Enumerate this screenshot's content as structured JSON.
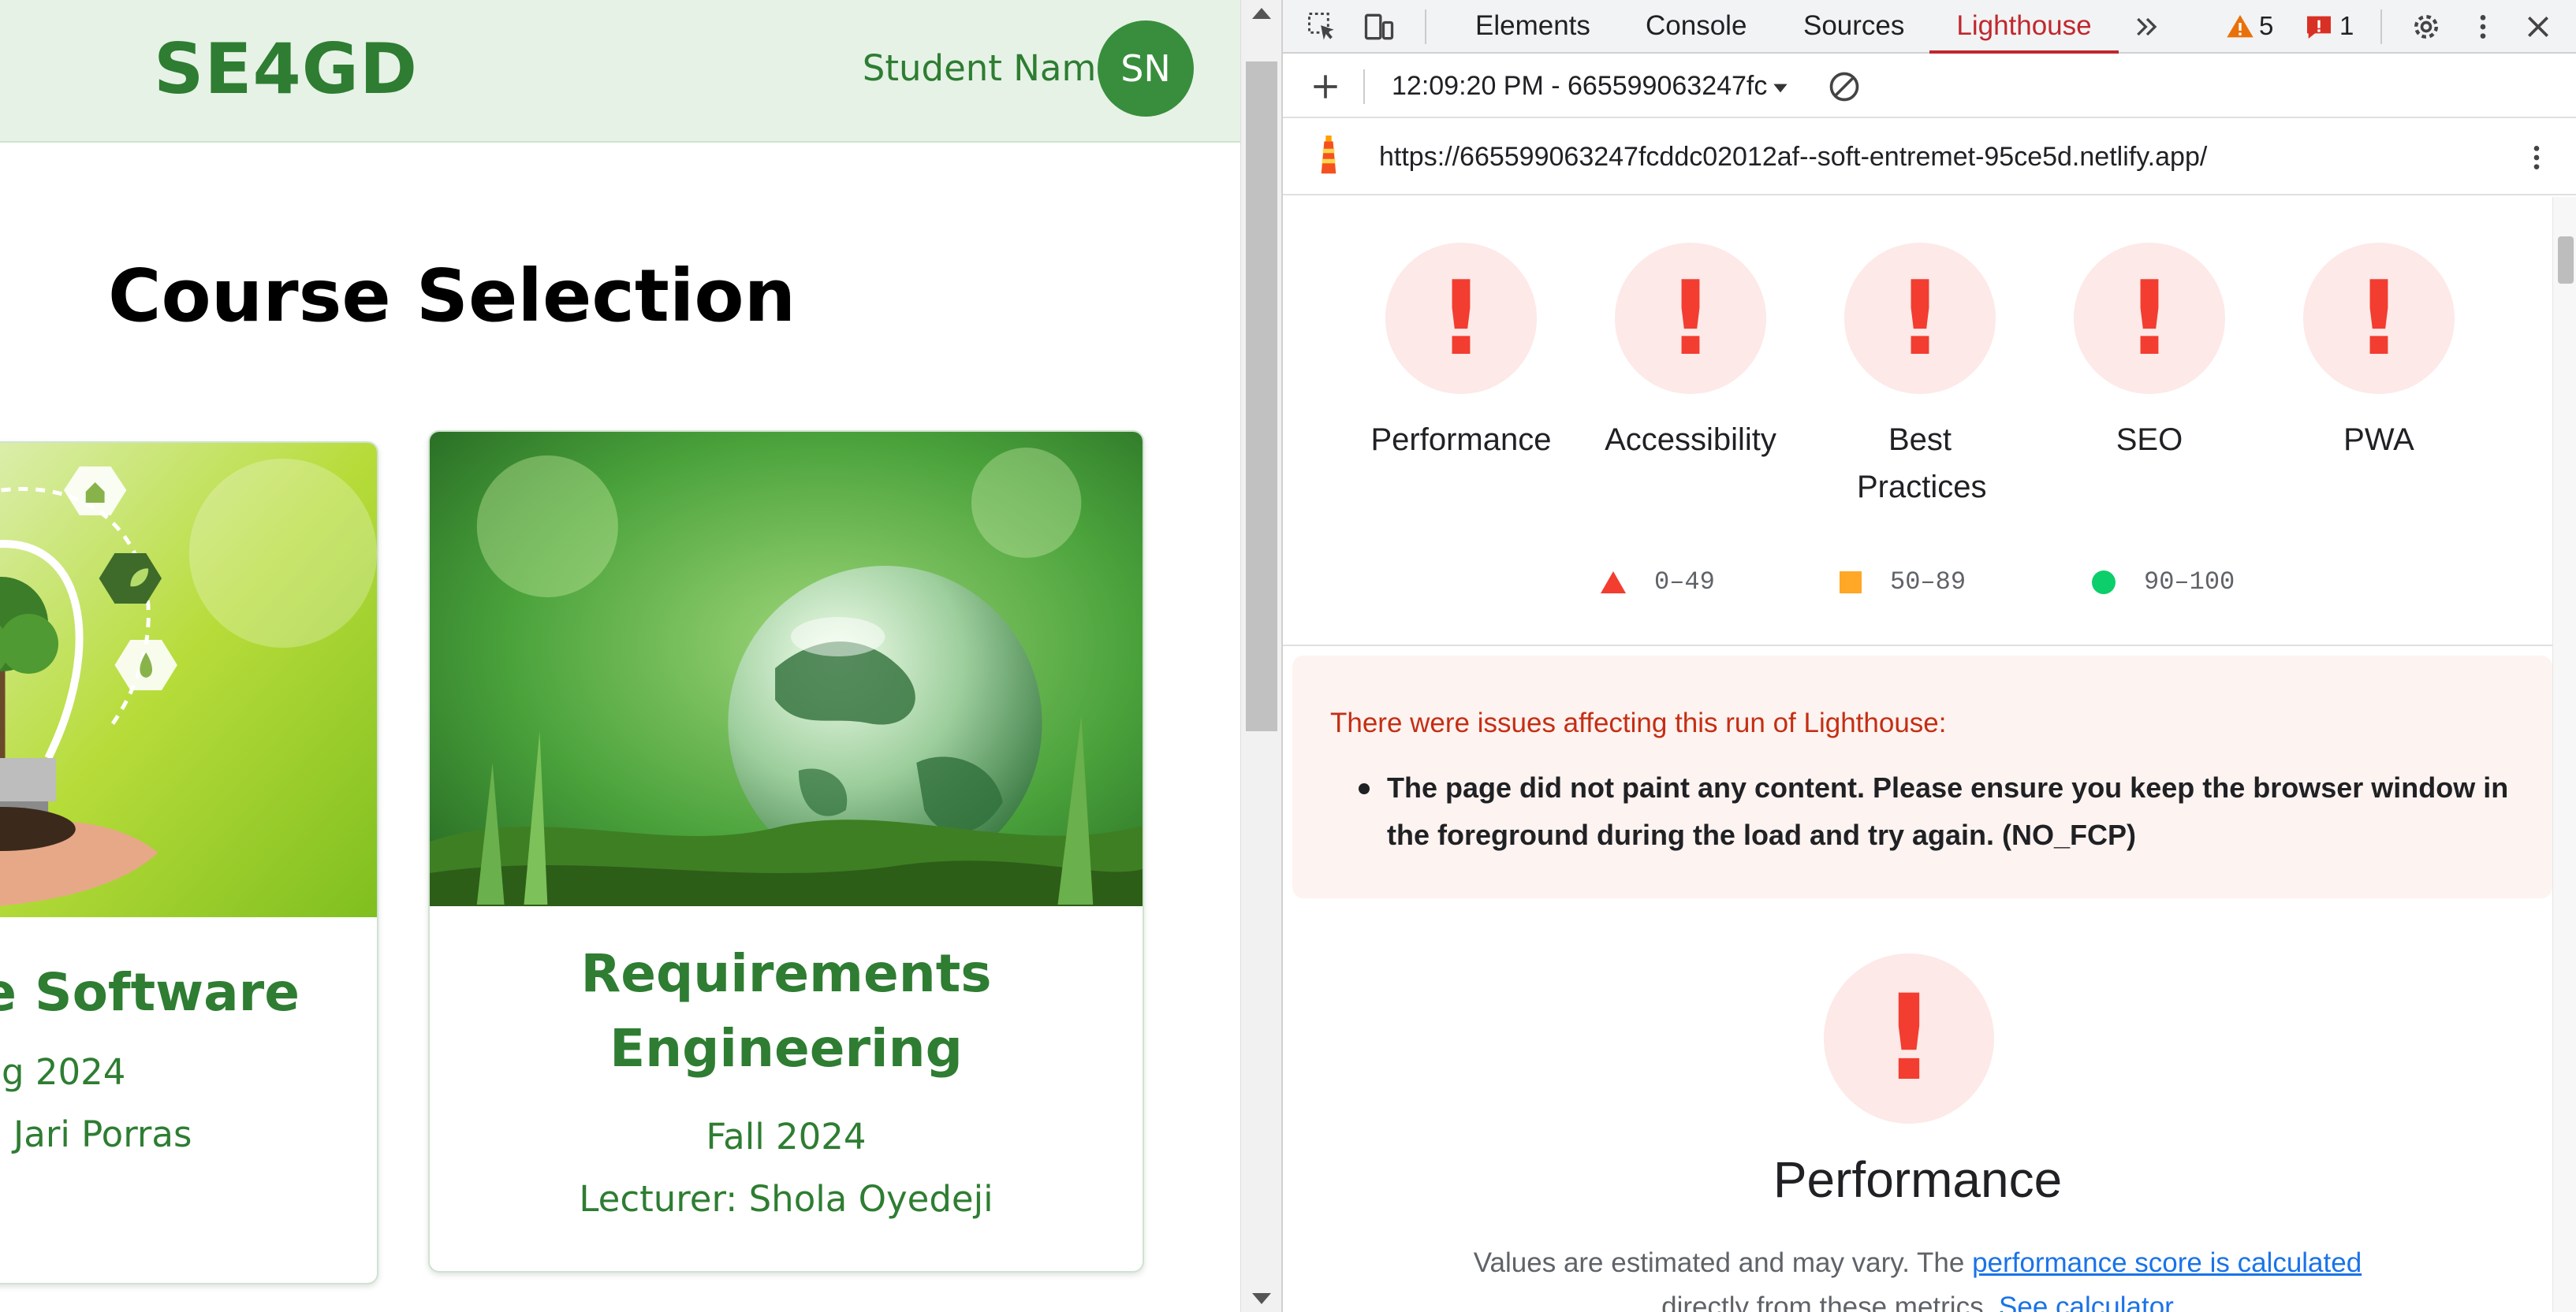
{
  "site": {
    "logo": "SE4GD",
    "student_name": "Student Name",
    "avatar_initials": "SN",
    "page_title": "Course Selection"
  },
  "courses": [
    {
      "title": "le Software",
      "season": "g 2024",
      "lecturer": "Jari Porras"
    },
    {
      "title_line1": "Requirements",
      "title_line2": "Engineering",
      "season": "Fall 2024",
      "lecturer": "Lecturer: Shola Oyedeji"
    }
  ],
  "devtools": {
    "tabs": [
      "Elements",
      "Console",
      "Sources",
      "Lighthouse"
    ],
    "active_tab": "Lighthouse",
    "warnings_count": "5",
    "errors_count": "1",
    "report_time": "12:09:20 PM - 665599063247fc",
    "report_url": "https://665599063247fcddc02012af--soft-entremet-95ce5d.netlify.app/",
    "categories": [
      "Performance",
      "Accessibility",
      "Best Practices",
      "SEO",
      "PWA"
    ],
    "gauge_mark": "!",
    "legend": [
      "0–49",
      "50–89",
      "90–100"
    ],
    "warning_title": "There were issues affecting this run of Lighthouse:",
    "warning_item": "The page did not paint any content. Please ensure you keep the browser window in the foreground during the load and try again. (NO_FCP)",
    "perf_title": "Performance",
    "perf_note_pre": "Values are estimated and may vary. The ",
    "perf_note_link1": "performance score is calculated",
    "perf_note_mid": "directly from these metrics. ",
    "perf_note_link2": "See calculator"
  },
  "colors": {
    "brand_green": "#2e7d32",
    "header_bg": "#e6f2e6",
    "lighthouse_red": "#f23d30",
    "gauge_bg": "#fde9e7",
    "active_tab": "#c1272d",
    "link_blue": "#1a73e8"
  },
  "icons": [
    "inspect-icon",
    "device-toolbar-icon",
    "more-tabs-icon",
    "warning-icon",
    "error-icon",
    "settings-icon",
    "kebab-menu-icon",
    "close-icon",
    "plus-icon",
    "dropdown-icon",
    "clear-icon",
    "lighthouse-icon"
  ]
}
